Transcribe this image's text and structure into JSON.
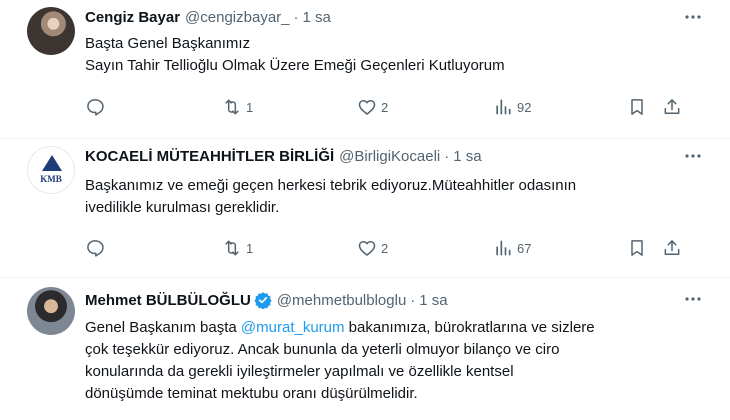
{
  "tweets": [
    {
      "name": "Cengiz Bayar",
      "handle": "@cengizbayar_",
      "dot": "·",
      "time": "1 sa",
      "lines": [
        "Başta Genel Başkanımız",
        "Sayın Tahir Tellioğlu Olmak Üzere Emeği Geçenleri Kutluyorum"
      ],
      "replies": "",
      "reposts": "1",
      "likes": "2",
      "views": "92"
    },
    {
      "name": "KOCAELİ MÜTEAHHİTLER BİRLİĞİ",
      "handle": "@BirligiKocaeli",
      "dot": "·",
      "time": "1 sa",
      "avatar_text": "KMB",
      "lines": [
        "Başkanımız ve emeği geçen herkesi tebrik ediyoruz.Müteahhitler odasının",
        "ivedilikle kurulması gereklidir."
      ],
      "replies": "",
      "reposts": "1",
      "likes": "2",
      "views": "67"
    },
    {
      "name": "Mehmet BÜLBÜLOĞLU",
      "handle": "@mehmetbulbloglu",
      "dot": "·",
      "time": "1 sa",
      "verified": true,
      "line1_pre": "Genel Başkanım başta ",
      "mention": "@murat_kurum",
      "line1_post": " bakanımıza, bürokratlarına ve sizlere",
      "lines": [
        "çok teşekkür ediyoruz. Ancak bununla da yeterli olmuyor bilanço ve ciro",
        "konularında da gerekli iyileştirmeler yapılmalı ve özellikle kentsel",
        "dönüşümde teminat mektubu oranı düşürülmelidir."
      ]
    }
  ],
  "colors": {
    "text": "#0f1419",
    "muted": "#536471",
    "accent": "#1d9bf0",
    "divider": "#eff3f4"
  },
  "icons": [
    "more-icon",
    "reply-icon",
    "repost-icon",
    "like-icon",
    "views-icon",
    "bookmark-icon",
    "share-icon",
    "verified-badge-icon"
  ]
}
